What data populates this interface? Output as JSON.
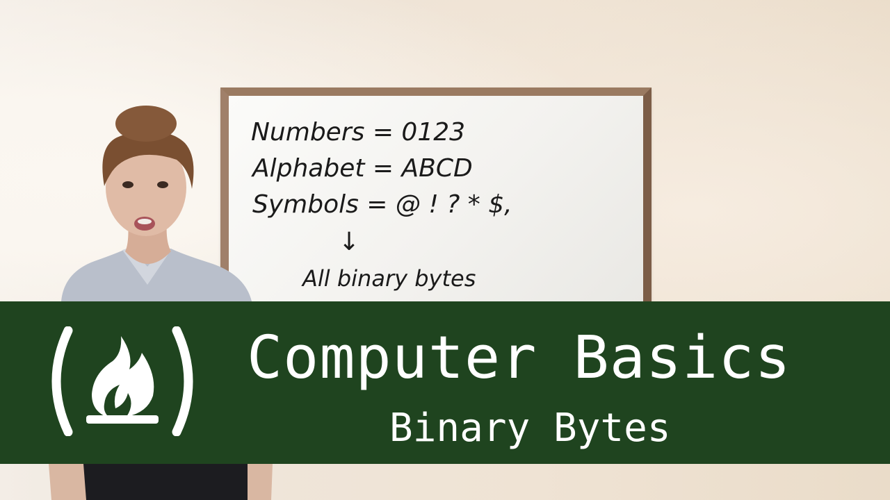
{
  "whiteboard": {
    "line_numbers": "Numbers = 0123",
    "line_alphabet": "Alphabet = ABCD",
    "line_symbols": "Symbols = @ ! ? * $,",
    "arrow": "↓",
    "line_conclusion": "All binary bytes"
  },
  "banner": {
    "title": "Computer Basics",
    "subtitle": "Binary Bytes",
    "color": "#1f441f",
    "logo_icon": "freecodecamp-flame-icon"
  }
}
